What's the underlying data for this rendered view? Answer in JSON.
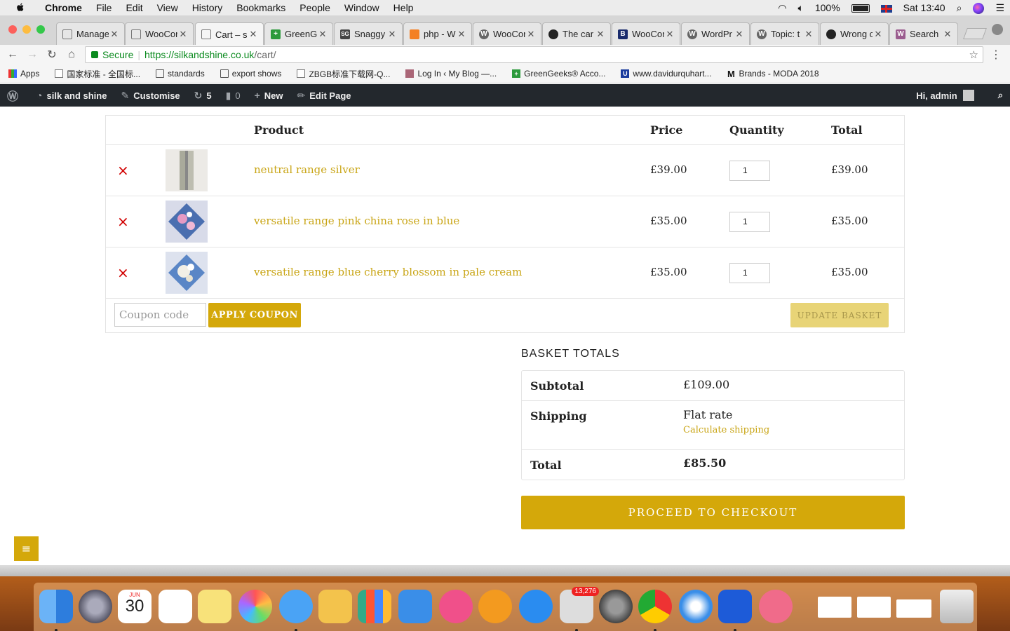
{
  "menubar": {
    "app": "Chrome",
    "items": [
      "File",
      "Edit",
      "View",
      "History",
      "Bookmarks",
      "People",
      "Window",
      "Help"
    ],
    "battery": "100%",
    "clock": "Sat 13:40"
  },
  "tabs": [
    {
      "label": "Manage",
      "icon": "page-icon"
    },
    {
      "label": "WooCor",
      "icon": "page-icon"
    },
    {
      "label": "Cart – s",
      "icon": "page-icon",
      "active": true
    },
    {
      "label": "GreenG",
      "icon": "greengeeks-icon"
    },
    {
      "label": "Snaggy",
      "icon": "sg-icon"
    },
    {
      "label": "php - W",
      "icon": "stackoverflow-icon"
    },
    {
      "label": "WooCor",
      "icon": "wordpress-icon"
    },
    {
      "label": "The car",
      "icon": "github-icon"
    },
    {
      "label": "WooCor",
      "icon": "b-icon"
    },
    {
      "label": "WordPr",
      "icon": "wordpress-icon"
    },
    {
      "label": "Topic: t",
      "icon": "wordpress-icon"
    },
    {
      "label": "Wrong c",
      "icon": "github-icon"
    },
    {
      "label": "Search",
      "icon": "woo-icon"
    }
  ],
  "address": {
    "secure_label": "Secure",
    "url_host": "https://silkandshine.co.uk",
    "url_path": "/cart/"
  },
  "bookmarks": [
    {
      "label": "Apps",
      "icon": "apps-grid-icon"
    },
    {
      "label": "国家标准 - 全国标...",
      "icon": "page-icon"
    },
    {
      "label": "standards",
      "icon": "folder-icon"
    },
    {
      "label": "export shows",
      "icon": "folder-icon"
    },
    {
      "label": "ZBGB标准下载网-Q...",
      "icon": "page-icon"
    },
    {
      "label": "Log In ‹ My Blog —...",
      "icon": "person-icon"
    },
    {
      "label": "GreenGeeks® Acco...",
      "icon": "greengeeks-icon"
    },
    {
      "label": "www.davidurquhart...",
      "icon": "u-icon"
    },
    {
      "label": "Brands - MODA 2018",
      "icon": "m-icon"
    }
  ],
  "wpbar": {
    "site": "silk and shine",
    "customise": "Customise",
    "updates": "5",
    "comments": "0",
    "new": "New",
    "edit": "Edit Page",
    "greeting": "Hi, admin"
  },
  "cart": {
    "headers": {
      "product": "Product",
      "price": "Price",
      "quantity": "Quantity",
      "total": "Total"
    },
    "items": [
      {
        "name": "neutral range silver",
        "price": "£39.00",
        "qty": "1",
        "total": "£39.00",
        "remove": "×"
      },
      {
        "name": "versatile range pink china rose in blue",
        "price": "£35.00",
        "qty": "1",
        "total": "£35.00",
        "remove": "×"
      },
      {
        "name": "versatile range blue cherry blossom in pale cream",
        "price": "£35.00",
        "qty": "1",
        "total": "£35.00",
        "remove": "×"
      }
    ],
    "coupon_placeholder": "Coupon code",
    "apply_label": "APPLY COUPON",
    "update_label": "UPDATE BASKET"
  },
  "totals": {
    "title": "BASKET TOTALS",
    "subtotal_label": "Subtotal",
    "subtotal": "£109.00",
    "shipping_label": "Shipping",
    "shipping_method": "Flat rate",
    "calc_shipping": "Calculate shipping",
    "total_label": "Total",
    "total": "£85.50",
    "checkout_label": "PROCEED TO CHECKOUT"
  },
  "dock": {
    "calendar_month": "JUN",
    "calendar_day": "30",
    "mail_badge": "13,276"
  },
  "colors": {
    "accent": "#d4a80a",
    "link": "#c9a515",
    "remove": "#d10000",
    "admin_bar": "#23282d"
  }
}
